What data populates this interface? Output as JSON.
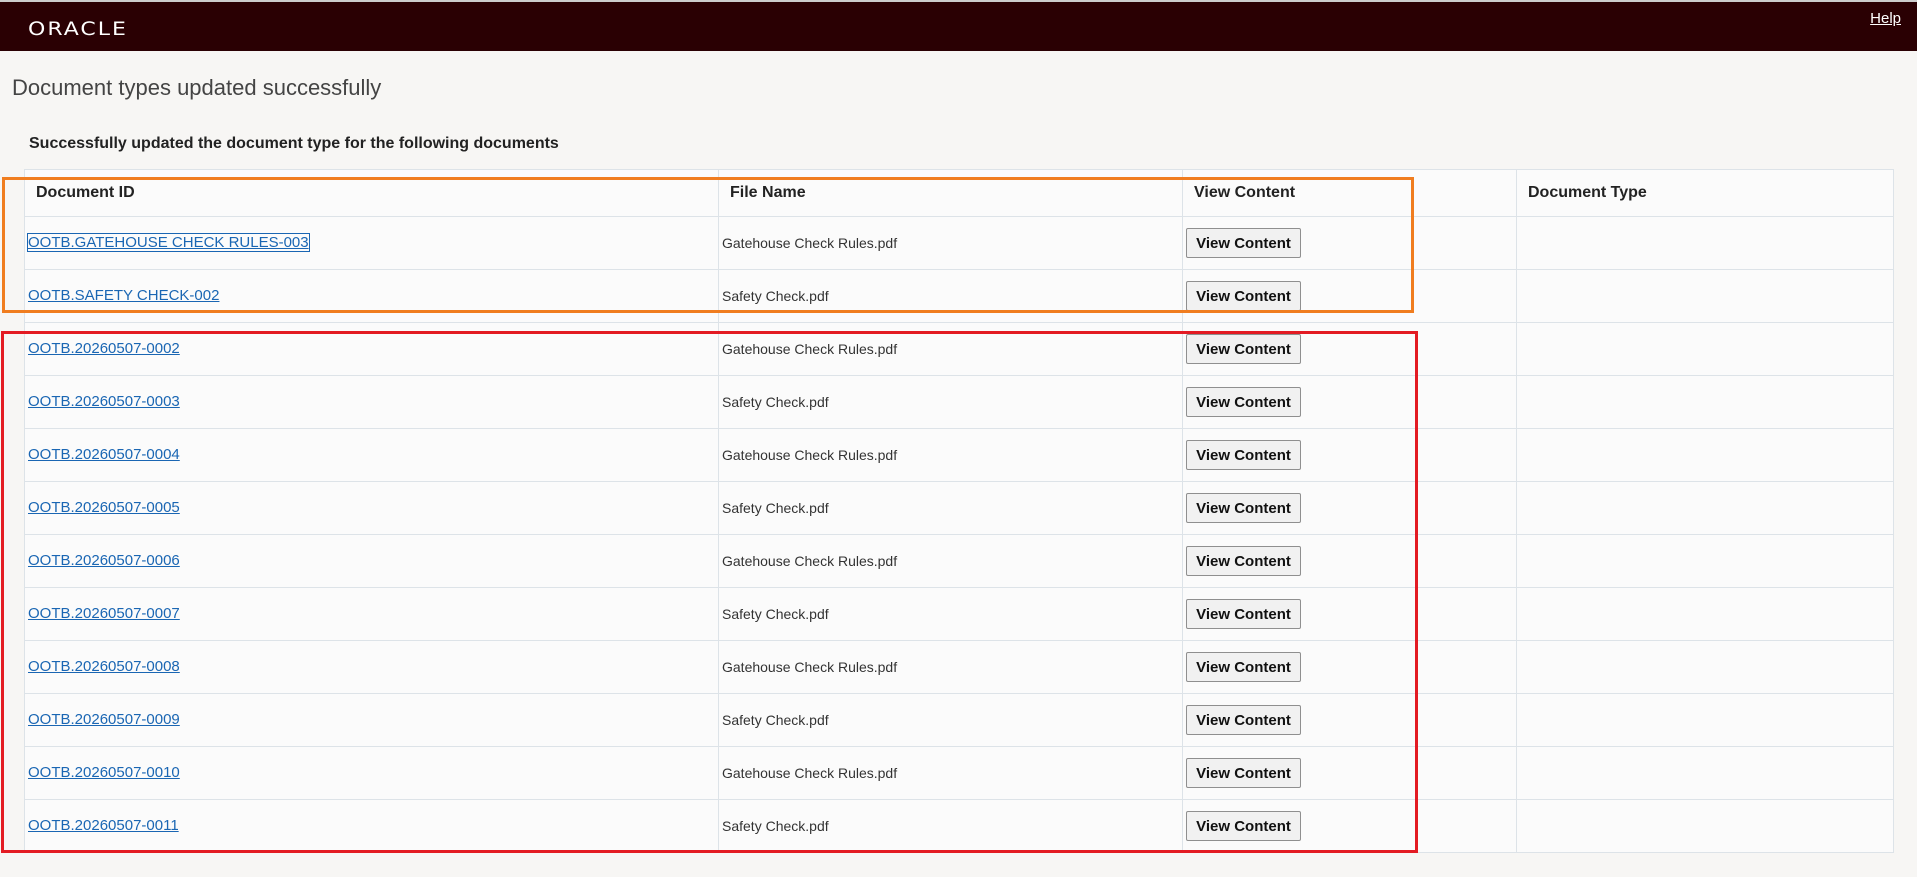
{
  "header": {
    "logo_text": "ORACLE",
    "help_label": "Help"
  },
  "page": {
    "title": "Document types updated successfully",
    "subtitle": "Successfully updated the document type for the following documents"
  },
  "table": {
    "columns": [
      "Document ID",
      "File Name",
      "View Content",
      "Document Type"
    ],
    "rows": [
      {
        "doc_id": "OOTB.GATEHOUSE CHECK RULES-003",
        "file_name": "Gatehouse Check Rules.pdf",
        "button": "View Content",
        "doc_type": ""
      },
      {
        "doc_id": "OOTB.SAFETY CHECK-002",
        "file_name": "Safety Check.pdf",
        "button": "View Content",
        "doc_type": ""
      },
      {
        "doc_id": "OOTB.20260507-0002",
        "file_name": "Gatehouse Check Rules.pdf",
        "button": "View Content",
        "doc_type": ""
      },
      {
        "doc_id": "OOTB.20260507-0003",
        "file_name": "Safety Check.pdf",
        "button": "View Content",
        "doc_type": ""
      },
      {
        "doc_id": "OOTB.20260507-0004",
        "file_name": "Gatehouse Check Rules.pdf",
        "button": "View Content",
        "doc_type": ""
      },
      {
        "doc_id": "OOTB.20260507-0005",
        "file_name": "Safety Check.pdf",
        "button": "View Content",
        "doc_type": ""
      },
      {
        "doc_id": "OOTB.20260507-0006",
        "file_name": "Gatehouse Check Rules.pdf",
        "button": "View Content",
        "doc_type": ""
      },
      {
        "doc_id": "OOTB.20260507-0007",
        "file_name": "Safety Check.pdf",
        "button": "View Content",
        "doc_type": ""
      },
      {
        "doc_id": "OOTB.20260507-0008",
        "file_name": "Gatehouse Check Rules.pdf",
        "button": "View Content",
        "doc_type": ""
      },
      {
        "doc_id": "OOTB.20260507-0009",
        "file_name": "Safety Check.pdf",
        "button": "View Content",
        "doc_type": ""
      },
      {
        "doc_id": "OOTB.20260507-0010",
        "file_name": "Gatehouse Check Rules.pdf",
        "button": "View Content",
        "doc_type": ""
      },
      {
        "doc_id": "OOTB.20260507-0011",
        "file_name": "Safety Check.pdf",
        "button": "View Content",
        "doc_type": ""
      }
    ]
  },
  "annotations": {
    "orange_color": "#f07d1f",
    "red_color": "#e31b23"
  }
}
